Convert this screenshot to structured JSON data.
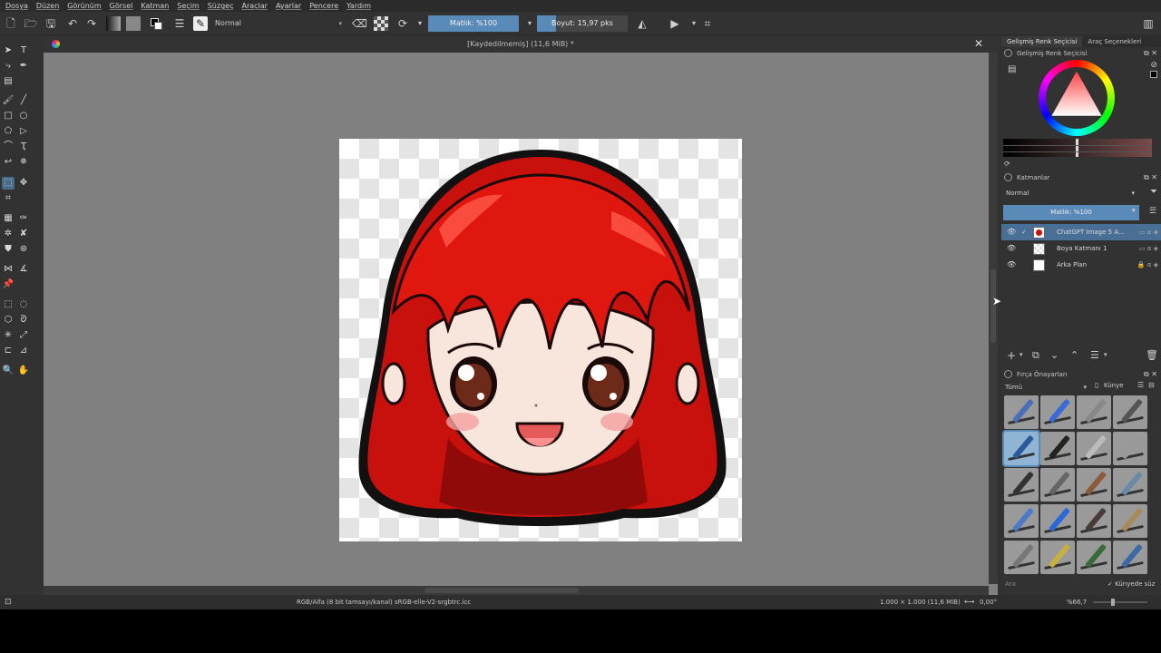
{
  "menu": [
    "Dosya",
    "Düzen",
    "Görünüm",
    "Görsel",
    "Katman",
    "Seçim",
    "Süzgeç",
    "Araçlar",
    "Ayarlar",
    "Pencere",
    "Yardım"
  ],
  "toolbar": {
    "blend_mode": "Normal",
    "opacity_label": "Matlık: %100",
    "size_label": "Boyut: 15,97 pks",
    "size_fill": 0.21
  },
  "document": {
    "title": "[Kaydedilmemiş]  (11,6 MiB) *"
  },
  "dock": {
    "tabs": [
      "Gelişmiş Renk Seçicisi",
      "Araç Seçenekleri"
    ],
    "color_panel_title": "Gelişmiş Renk Seçicisi",
    "layers_panel_title": "Katmanlar",
    "layers_blend": "Normal",
    "layers_opacity": "Matlık: %100",
    "layers": [
      {
        "name": "ChatGPT Image 5 A...",
        "selected": true
      },
      {
        "name": "Boya Katmanı 1",
        "selected": false
      },
      {
        "name": "Arka Plan",
        "selected": false
      }
    ],
    "presets_panel_title": "Fırça Önayarları",
    "presets_filter": "Tümü",
    "presets_tag": "Künye",
    "search_placeholder": "Ara",
    "filter_in_tag": "Künyede süz"
  },
  "status": {
    "color_space": "RGB/Alfa (8 bit tamsayı/kanal)  sRGB-elle-V2-srgbtrc.icc",
    "dimensions": "1.000 × 1.000 (11,6 MiB)",
    "rotation": "0,00°",
    "zoom": "%66,7"
  },
  "colors": {
    "accent": "#5a8ab8",
    "hair": "#d8140e",
    "bg_canvas": "#808080"
  }
}
